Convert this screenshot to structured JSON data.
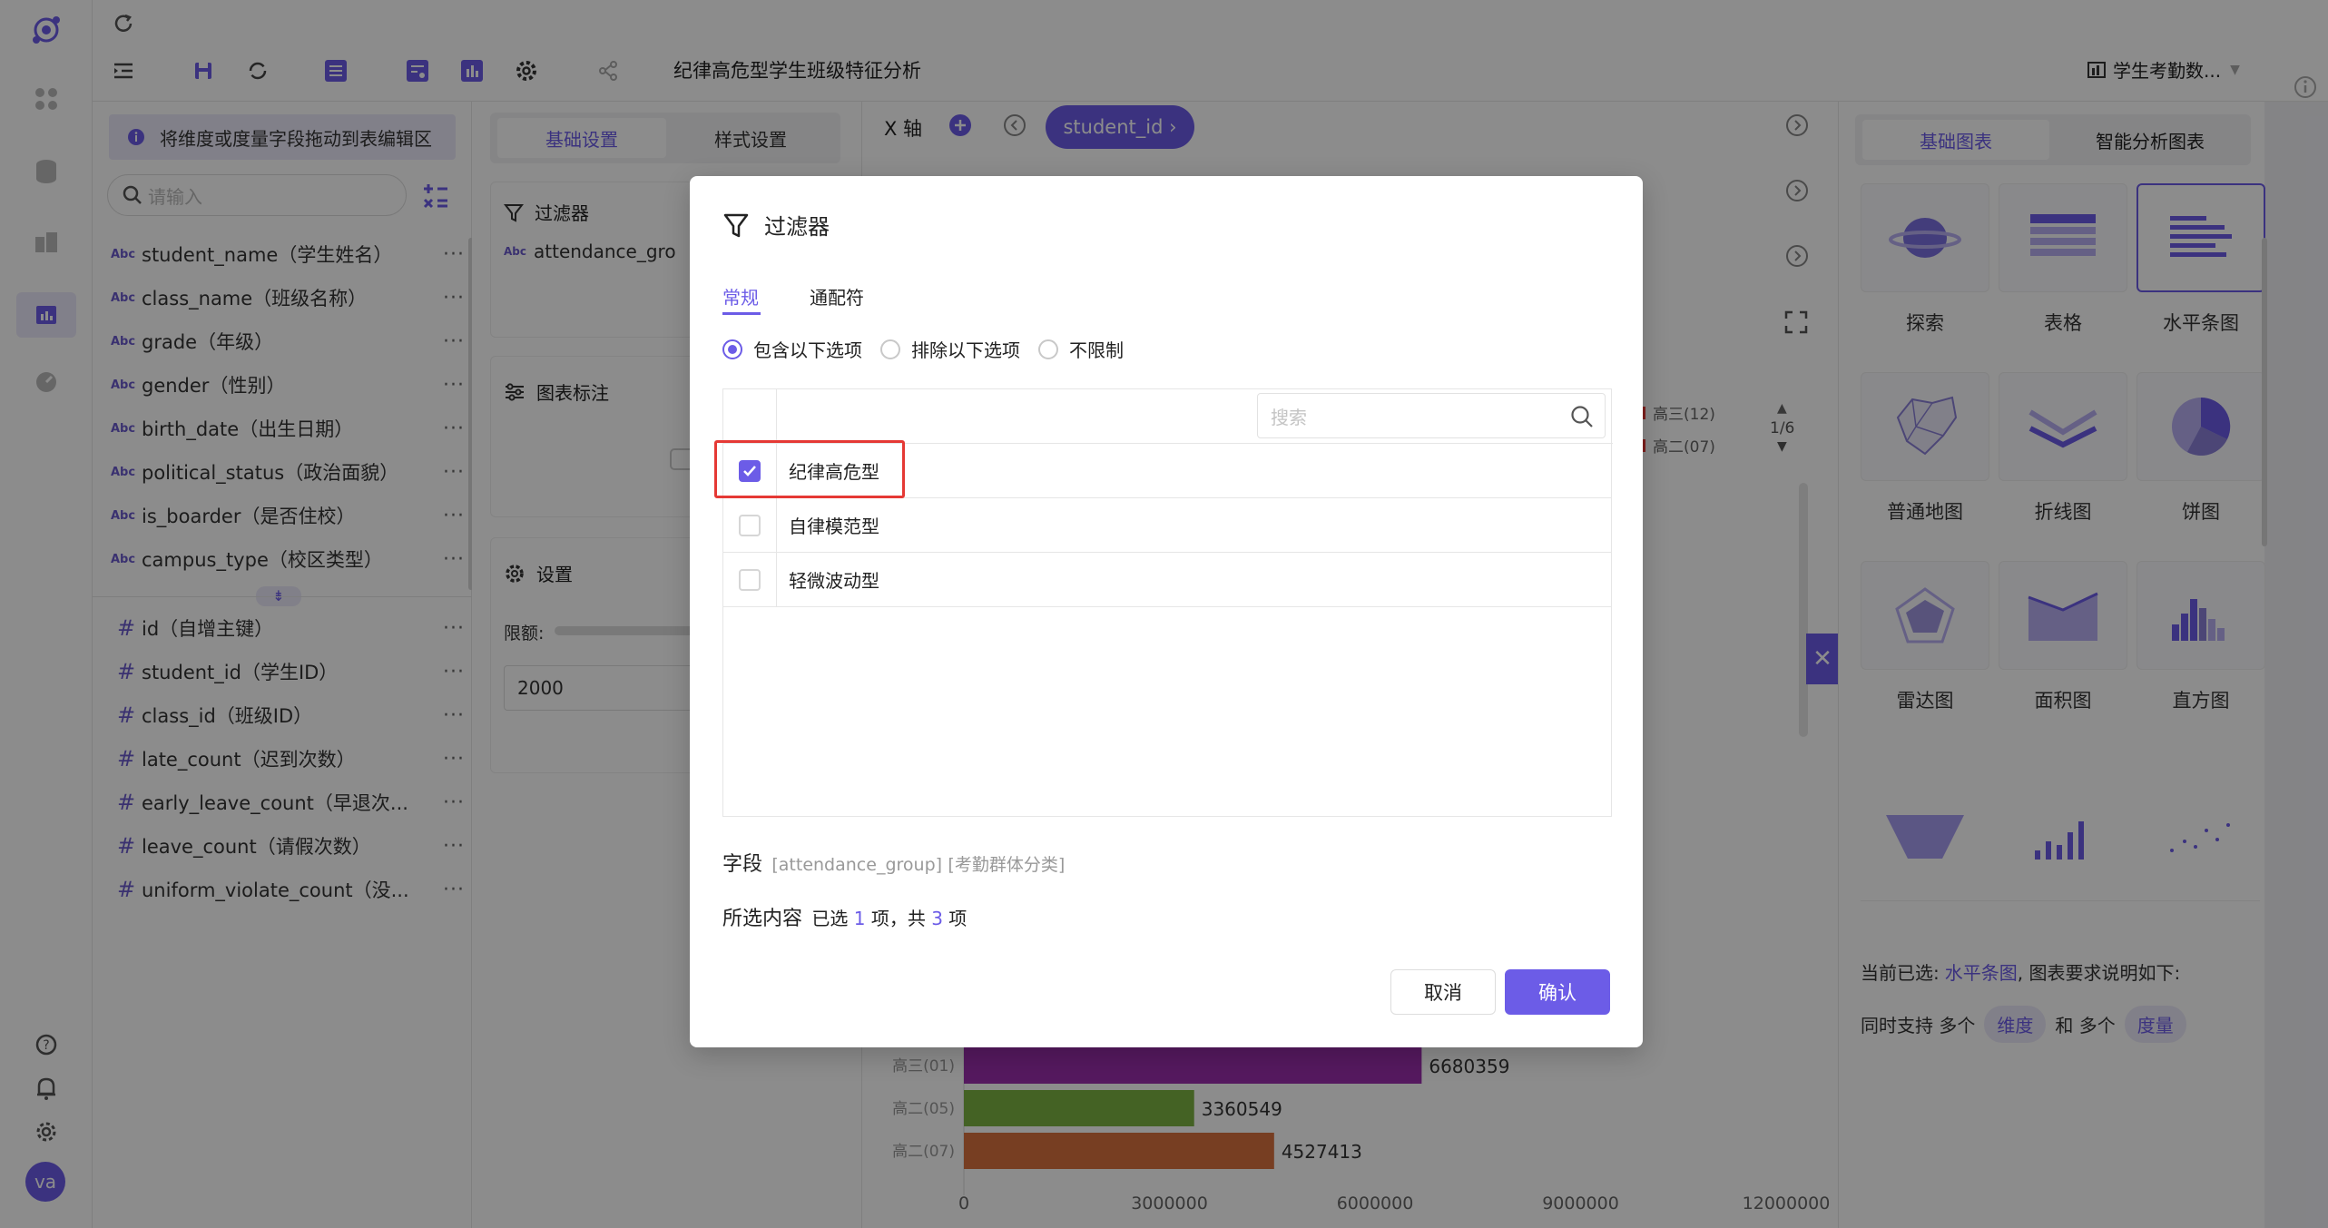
{
  "rail": {
    "avatar_initials": "va"
  },
  "toolbar": {
    "report_title": "纪律高危型学生班级特征分析",
    "dataset_label": "学生考勤数..."
  },
  "fields_panel": {
    "tip": "将维度或度量字段拖动到表编辑区",
    "search_placeholder": "请输入",
    "dimension_tag": "Abc",
    "dimensions": [
      {
        "label": "student_name（学生姓名）"
      },
      {
        "label": "class_name（班级名称）"
      },
      {
        "label": "grade（年级）"
      },
      {
        "label": "gender（性别）"
      },
      {
        "label": "birth_date（出生日期）"
      },
      {
        "label": "political_status（政治面貌）"
      },
      {
        "label": "is_boarder（是否住校）"
      },
      {
        "label": "campus_type（校区类型）"
      }
    ],
    "measures": [
      {
        "label": "id（自增主键）"
      },
      {
        "label": "student_id（学生ID）"
      },
      {
        "label": "class_id（班级ID）"
      },
      {
        "label": "late_count（迟到次数）"
      },
      {
        "label": "early_leave_count（早退次..."
      },
      {
        "label": "leave_count（请假次数）"
      },
      {
        "label": "uniform_violate_count（没..."
      }
    ],
    "more_label": "···"
  },
  "settings_panel": {
    "tab_basic": "基础设置",
    "tab_style": "样式设置",
    "filter_title": "过滤器",
    "filter_field": "attendance_gro",
    "annotation_title": "图表标注",
    "settings_title": "设置",
    "limit_label": "限额:",
    "limit_value": "2000"
  },
  "canvas": {
    "x_axis_label": "X 轴",
    "x_axis_chip": "student_id ›",
    "legend_items": [
      "高三(12)",
      "高二(07)"
    ],
    "page_indicator": "1/6"
  },
  "chart_data": {
    "type": "bar",
    "orientation": "horizontal",
    "categories": [
      "高三(01)",
      "高二(05)",
      "高二(07)"
    ],
    "values": [
      6680359,
      3360549,
      4527413
    ],
    "value_labels": [
      "6680359",
      "3360549",
      "4527413"
    ],
    "colors": [
      "#9b2fae",
      "#7cb342",
      "#d9713f"
    ],
    "x_ticks": [
      "0",
      "3000000",
      "6000000",
      "9000000",
      "12000000"
    ],
    "xlim": [
      0,
      12000000
    ]
  },
  "charts_panel": {
    "tab_basic": "基础图表",
    "tab_smart": "智能分析图表",
    "chart_types": [
      {
        "label": "探索",
        "icon": "explore-icon"
      },
      {
        "label": "表格",
        "icon": "table-icon"
      },
      {
        "label": "水平条图",
        "icon": "horizontal-bar-icon"
      },
      {
        "label": "普通地图",
        "icon": "map-icon"
      },
      {
        "label": "折线图",
        "icon": "line-chart-icon"
      },
      {
        "label": "饼图",
        "icon": "pie-chart-icon"
      },
      {
        "label": "雷达图",
        "icon": "radar-chart-icon"
      },
      {
        "label": "面积图",
        "icon": "area-chart-icon"
      },
      {
        "label": "直方图",
        "icon": "histogram-icon"
      }
    ],
    "current_prefix": "当前已选:",
    "current_chart": "水平条图",
    "current_suffix": ", 图表要求说明如下:",
    "support_prefix": "同时支持 多个",
    "support_dimension": "维度",
    "support_mid": "和 多个",
    "support_measure": "度量"
  },
  "modal": {
    "title": "过滤器",
    "tab_normal": "常规",
    "tab_wildcard": "通配符",
    "radio_include": "包含以下选项",
    "radio_exclude": "排除以下选项",
    "radio_unlimited": "不限制",
    "search_placeholder": "搜索",
    "options": [
      {
        "label": "纪律高危型",
        "checked": true
      },
      {
        "label": "自律模范型",
        "checked": false
      },
      {
        "label": "轻微波动型",
        "checked": false
      }
    ],
    "field_label": "字段",
    "field_name": "[attendance_group]",
    "field_alias": "[考勤群体分类]",
    "selected_label": "所选内容",
    "selected_prefix": "已选",
    "selected_count": "1",
    "selected_mid": "项，共",
    "total_count": "3",
    "selected_suffix": "项",
    "cancel_label": "取消",
    "confirm_label": "确认"
  },
  "colors": {
    "accent": "#6c5ce7",
    "highlight_border": "#e53935"
  }
}
